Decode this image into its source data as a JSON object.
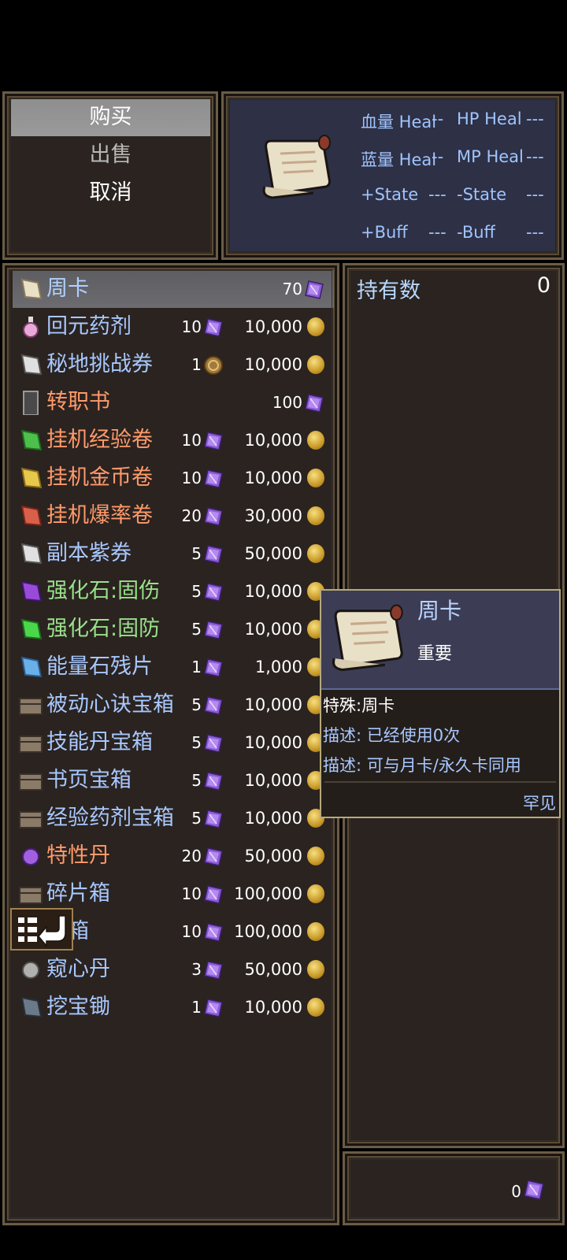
{
  "commands": [
    "购买",
    "出售",
    "取消"
  ],
  "status": {
    "rows": [
      {
        "left_label": "血量 Heal",
        "left_val": "--",
        "right_label": "HP Heal",
        "right_val": "---"
      },
      {
        "left_label": "蓝量 Heal",
        "left_val": "--",
        "right_label": "MP Heal",
        "right_val": "---"
      },
      {
        "left_label": "+State",
        "left_val": "---",
        "right_label": "-State",
        "right_val": "---"
      },
      {
        "left_label": "+Buff",
        "left_val": "---",
        "right_label": "-Buff",
        "right_val": "---"
      }
    ]
  },
  "items": [
    {
      "name": "周卡",
      "gem_qty": "70",
      "gold": "",
      "icon": "scroll-icon",
      "color": "sel"
    },
    {
      "name": "回元药剂",
      "gem_qty": "10",
      "gold": "10,000",
      "icon": "potion-icon",
      "color": "blue"
    },
    {
      "name": "秘地挑战券",
      "gem_qty": "1",
      "gold": "10,000",
      "icon": "ticket-icon",
      "color": "blue",
      "coin_price": true
    },
    {
      "name": "转职书",
      "gem_qty": "100",
      "gold": "",
      "icon": "book-icon",
      "color": "orange"
    },
    {
      "name": "挂机经验卷",
      "gem_qty": "10",
      "gold": "10,000",
      "icon": "green-scroll-icon",
      "color": "orange"
    },
    {
      "name": "挂机金币卷",
      "gem_qty": "10",
      "gold": "10,000",
      "icon": "yellow-scroll-icon",
      "color": "orange"
    },
    {
      "name": "挂机爆率卷",
      "gem_qty": "20",
      "gold": "30,000",
      "icon": "red-scroll-icon",
      "color": "orange"
    },
    {
      "name": "副本紫券",
      "gem_qty": "5",
      "gold": "50,000",
      "icon": "ticket-icon",
      "color": "blue"
    },
    {
      "name": "强化石:固伤",
      "gem_qty": "5",
      "gold": "10,000",
      "icon": "purple-stone-icon",
      "color": "green"
    },
    {
      "name": "强化石:固防",
      "gem_qty": "5",
      "gold": "10,000",
      "icon": "green-stone-icon",
      "color": "green"
    },
    {
      "name": "能量石残片",
      "gem_qty": "1",
      "gold": "1,000",
      "icon": "shard-icon",
      "color": "blue"
    },
    {
      "name": "被动心诀宝箱",
      "gem_qty": "5",
      "gold": "10,000",
      "icon": "chest-icon",
      "color": "blue"
    },
    {
      "name": "技能丹宝箱",
      "gem_qty": "5",
      "gold": "10,000",
      "icon": "chest-icon",
      "color": "blue"
    },
    {
      "name": "书页宝箱",
      "gem_qty": "5",
      "gold": "10,000",
      "icon": "chest-icon",
      "color": "blue"
    },
    {
      "name": "经验药剂宝箱",
      "gem_qty": "5",
      "gold": "10,000",
      "icon": "chest-icon",
      "color": "blue"
    },
    {
      "name": "特性丹",
      "gem_qty": "20",
      "gold": "50,000",
      "icon": "orb-icon",
      "color": "orange"
    },
    {
      "name": "碎片箱",
      "gem_qty": "10",
      "gold": "100,000",
      "icon": "chest-icon",
      "color": "blue"
    },
    {
      "name": "奖箱",
      "gem_qty": "10",
      "gold": "100,000",
      "icon": "chest-icon",
      "color": "blue"
    },
    {
      "name": "窥心丹",
      "gem_qty": "3",
      "gold": "50,000",
      "icon": "gray-orb-icon",
      "color": "blue"
    },
    {
      "name": "挖宝锄",
      "gem_qty": "1",
      "gold": "10,000",
      "icon": "hoe-icon",
      "color": "blue"
    }
  ],
  "owned": {
    "label": "持有数",
    "value": "0"
  },
  "currency": {
    "gems": "0"
  },
  "tooltip": {
    "name": "周卡",
    "rarity": "重要",
    "special_label": "特殊:",
    "special_value": "周卡",
    "desc1_label": "描述:",
    "desc1_value": "已经使用0次",
    "desc2_label": "描述:",
    "desc2_value": "可与月卡/永久卡同用",
    "rarity_tag": "罕见"
  },
  "colors": {
    "gem": "#8b5bd6",
    "gold": "#d4a83a",
    "border": "#6b5c45"
  }
}
